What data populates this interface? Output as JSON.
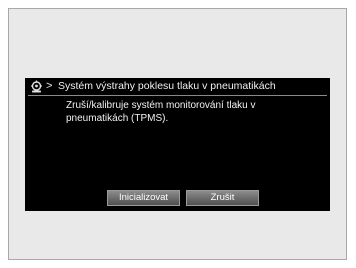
{
  "dialog": {
    "title": "Systém výstrahy poklesu tlaku v pneumatikách",
    "separator": ">",
    "message_line1": "Zruší/kalibruje systém monitorování tlaku v",
    "message_line2": "pneumatikách (TPMS).",
    "icon": "settings-car-icon"
  },
  "buttons": {
    "initialize_label": "Inicializovat",
    "cancel_label": "Zrušit"
  },
  "colors": {
    "frame_bg": "#e9e9e9",
    "screen_bg": "#000000",
    "text": "#f0f0f0",
    "button_top": "#8c8c8c",
    "button_bottom": "#4f4f4f"
  }
}
